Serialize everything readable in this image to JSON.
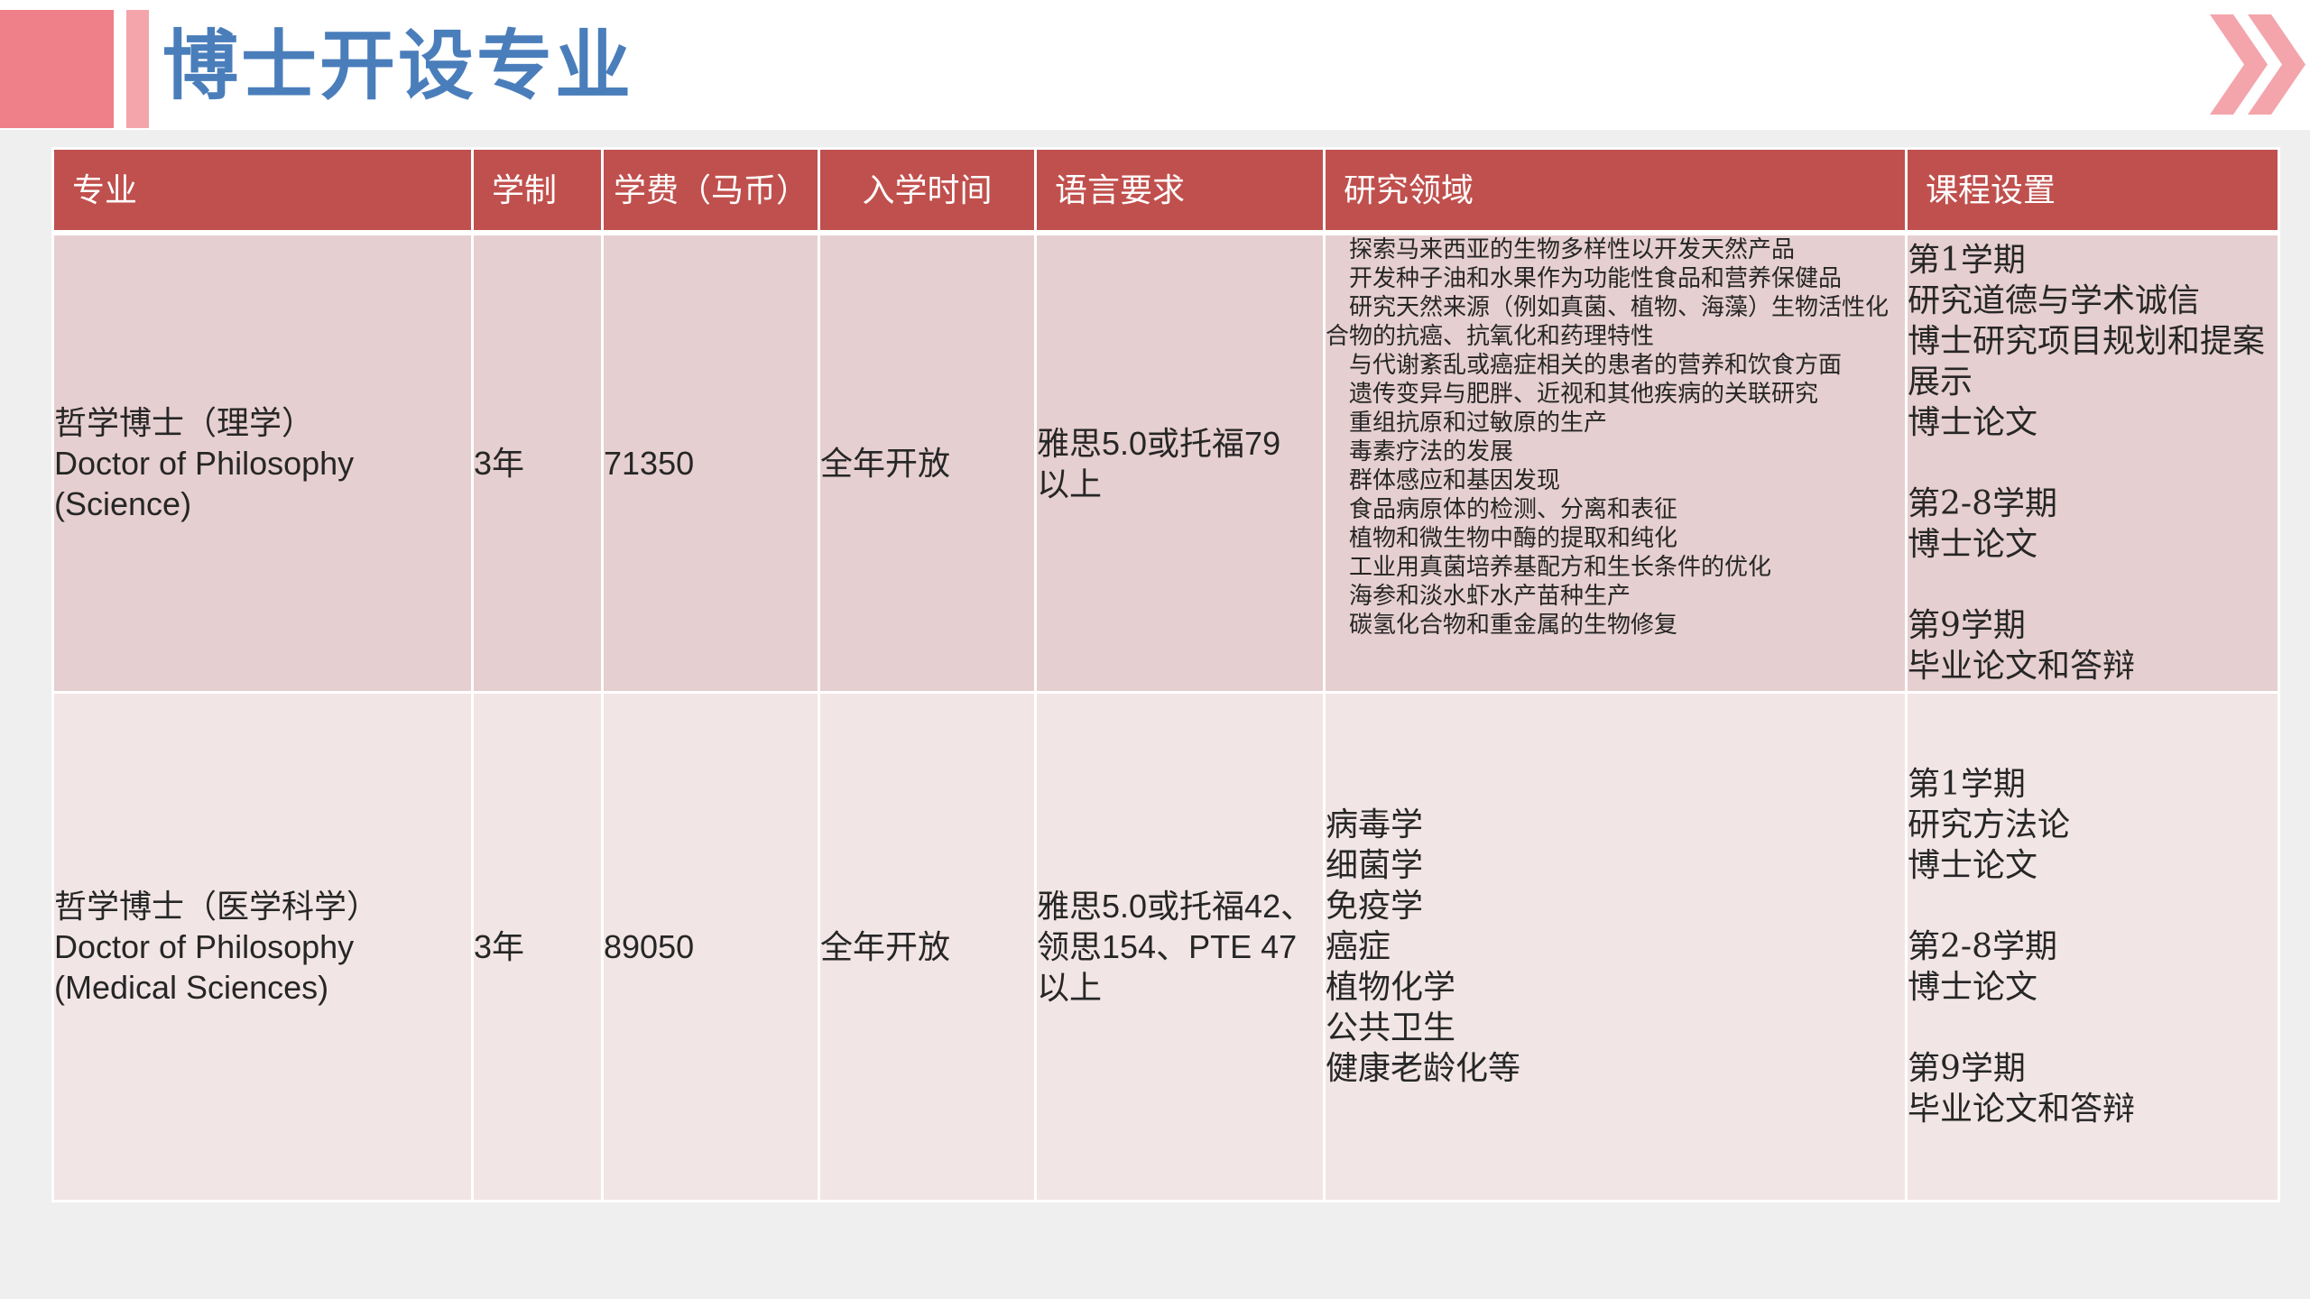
{
  "title": "博士开设专业",
  "colors": {
    "title": "#4a7ebb",
    "header_bg": "#c0504d",
    "row_a": "#e6cfd0",
    "row_b": "#f2e5e6",
    "deco_strong": "#ef7f88",
    "deco_light": "#f3a5ab",
    "page_bg": "#efefef"
  },
  "icons": {
    "corner": "double-chevron-right-icon"
  },
  "table": {
    "headers": [
      "专业",
      "学制",
      "学费（马币）",
      "入学时间",
      "语言要求",
      "研究领域",
      "课程设置"
    ],
    "rows": [
      {
        "program": [
          "哲学博士（理学）",
          "Doctor of Philosophy",
          "(Science)"
        ],
        "duration": "3年",
        "tuition": "71350",
        "intake": "全年开放",
        "language": [
          "雅思5.0或托福79",
          "以上"
        ],
        "research": [
          "探索马来西亚的生物多样性以开发天然产品",
          "开发种子油和水果作为功能性食品和营养保健品",
          "研究天然来源（例如真菌、植物、海藻）生物活性化合物的抗癌、抗氧化和药理特性",
          "与代谢紊乱或癌症相关的患者的营养和饮食方面",
          "遗传变异与肥胖、近视和其他疾病的关联研究",
          "重组抗原和过敏原的生产",
          "毒素疗法的发展",
          "群体感应和基因发现",
          "食品病原体的检测、分离和表征",
          "植物和微生物中酶的提取和纯化",
          "工业用真菌培养基配方和生长条件的优化",
          "海参和淡水虾水产苗种生产",
          "碳氢化合物和重金属的生物修复"
        ],
        "courses": [
          {
            "term": "第1学期",
            "items": [
              "研究道德与学术诚信",
              "博士研究项目规划和提案展示",
              "博士论文"
            ]
          },
          {
            "term": "第2-8学期",
            "items": [
              "博士论文"
            ]
          },
          {
            "term": "第9学期",
            "items": [
              "毕业论文和答辩"
            ]
          }
        ]
      },
      {
        "program": [
          "哲学博士（医学科学）",
          "Doctor of Philosophy",
          "(Medical Sciences)"
        ],
        "duration": "3年",
        "tuition": "89050",
        "intake": "全年开放",
        "language": [
          "雅思5.0或托福42、",
          "领思154、PTE 47",
          "以上"
        ],
        "research": [
          "病毒学",
          "细菌学",
          "免疫学",
          "癌症",
          "植物化学",
          "公共卫生",
          "健康老龄化等"
        ],
        "courses": [
          {
            "term": "第1学期",
            "items": [
              "研究方法论",
              "博士论文"
            ]
          },
          {
            "term": "第2-8学期",
            "items": [
              "博士论文"
            ]
          },
          {
            "term": "第9学期",
            "items": [
              "毕业论文和答辩"
            ]
          }
        ]
      }
    ]
  }
}
